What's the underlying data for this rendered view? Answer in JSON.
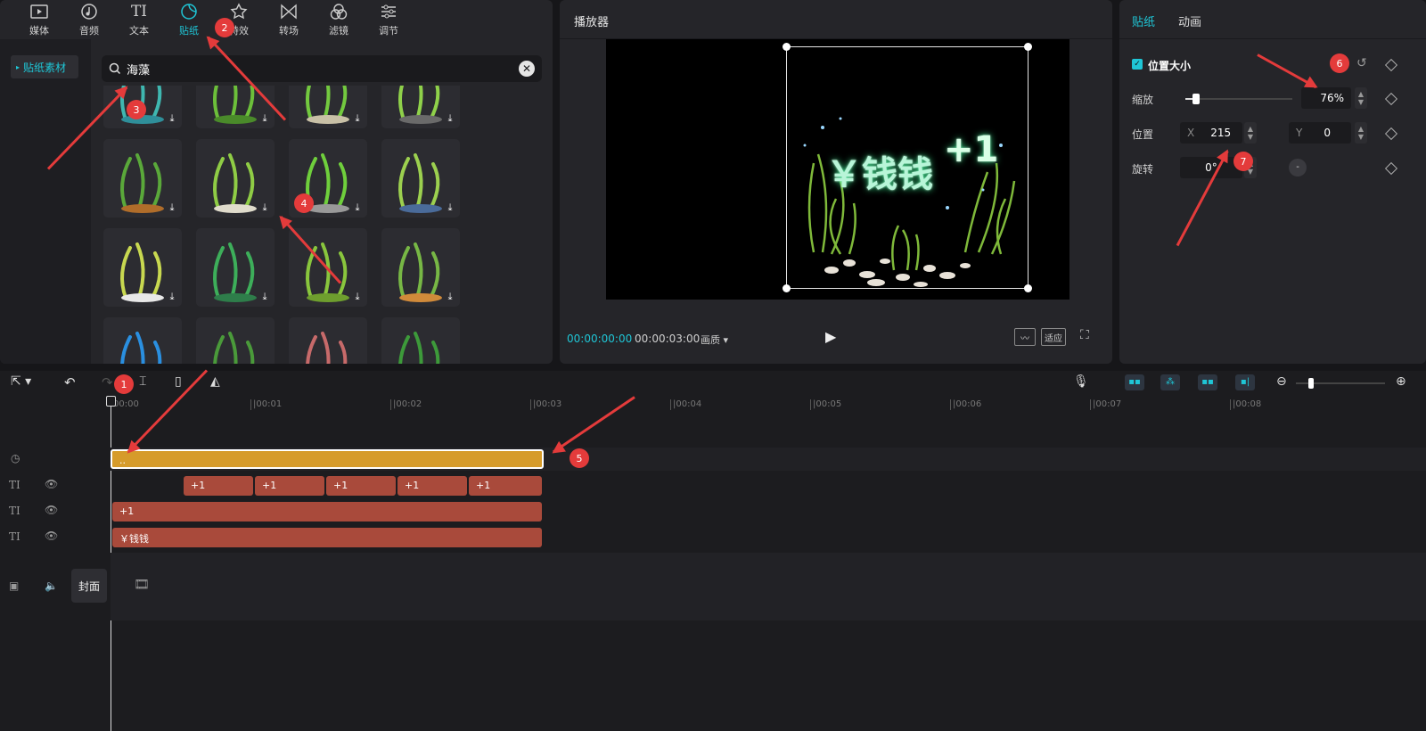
{
  "toolbar": {
    "tabs": [
      {
        "label": "媒体",
        "icon": "media-icon"
      },
      {
        "label": "音频",
        "icon": "audio-icon"
      },
      {
        "label": "文本",
        "icon": "text-icon"
      },
      {
        "label": "贴纸",
        "icon": "sticker-icon"
      },
      {
        "label": "特效",
        "icon": "effects-icon"
      },
      {
        "label": "转场",
        "icon": "transition-icon"
      },
      {
        "label": "滤镜",
        "icon": "filter-icon"
      },
      {
        "label": "调节",
        "icon": "adjust-icon"
      }
    ],
    "text_icon_glyph": "TI"
  },
  "sidebar": {
    "item": "贴纸素材"
  },
  "search": {
    "value": "海藻"
  },
  "player": {
    "title": "播放器",
    "current_time": "00:00:00:00",
    "total_time": "00:00:03:00",
    "quality": "画质",
    "fit": "适应",
    "preview_text": "￥钱钱",
    "preview_plus": "+1"
  },
  "props": {
    "tabs": [
      "贴纸",
      "动画"
    ],
    "section": "位置大小",
    "scale_label": "缩放",
    "scale_value": "76%",
    "scale_level": 0.1,
    "position_label": "位置",
    "x_label": "X",
    "x_value": "215",
    "y_label": "Y",
    "y_value": "0",
    "rotate_label": "旋转",
    "rotate_value": "0°"
  },
  "timeline": {
    "ruler": [
      "00:00",
      "|00:01",
      "|00:02",
      "|00:03",
      "|00:04",
      "|00:05",
      "|00:06",
      "|00:07",
      "|00:08"
    ],
    "sticker_clip": "..",
    "plus_clips": [
      "+1",
      "+1",
      "+1",
      "+1",
      "+1"
    ],
    "plus_long": "+1",
    "money_clip": "￥钱钱",
    "cover": "封面",
    "text_track_icon": "TI"
  },
  "annotations": [
    "1",
    "2",
    "3",
    "4",
    "5",
    "6",
    "7"
  ],
  "colors": {
    "accent": "#1fc6d6",
    "annotation": "#e43b3b",
    "text_clip": "#a94a3b",
    "sticker_clip": "#d69b2a"
  }
}
